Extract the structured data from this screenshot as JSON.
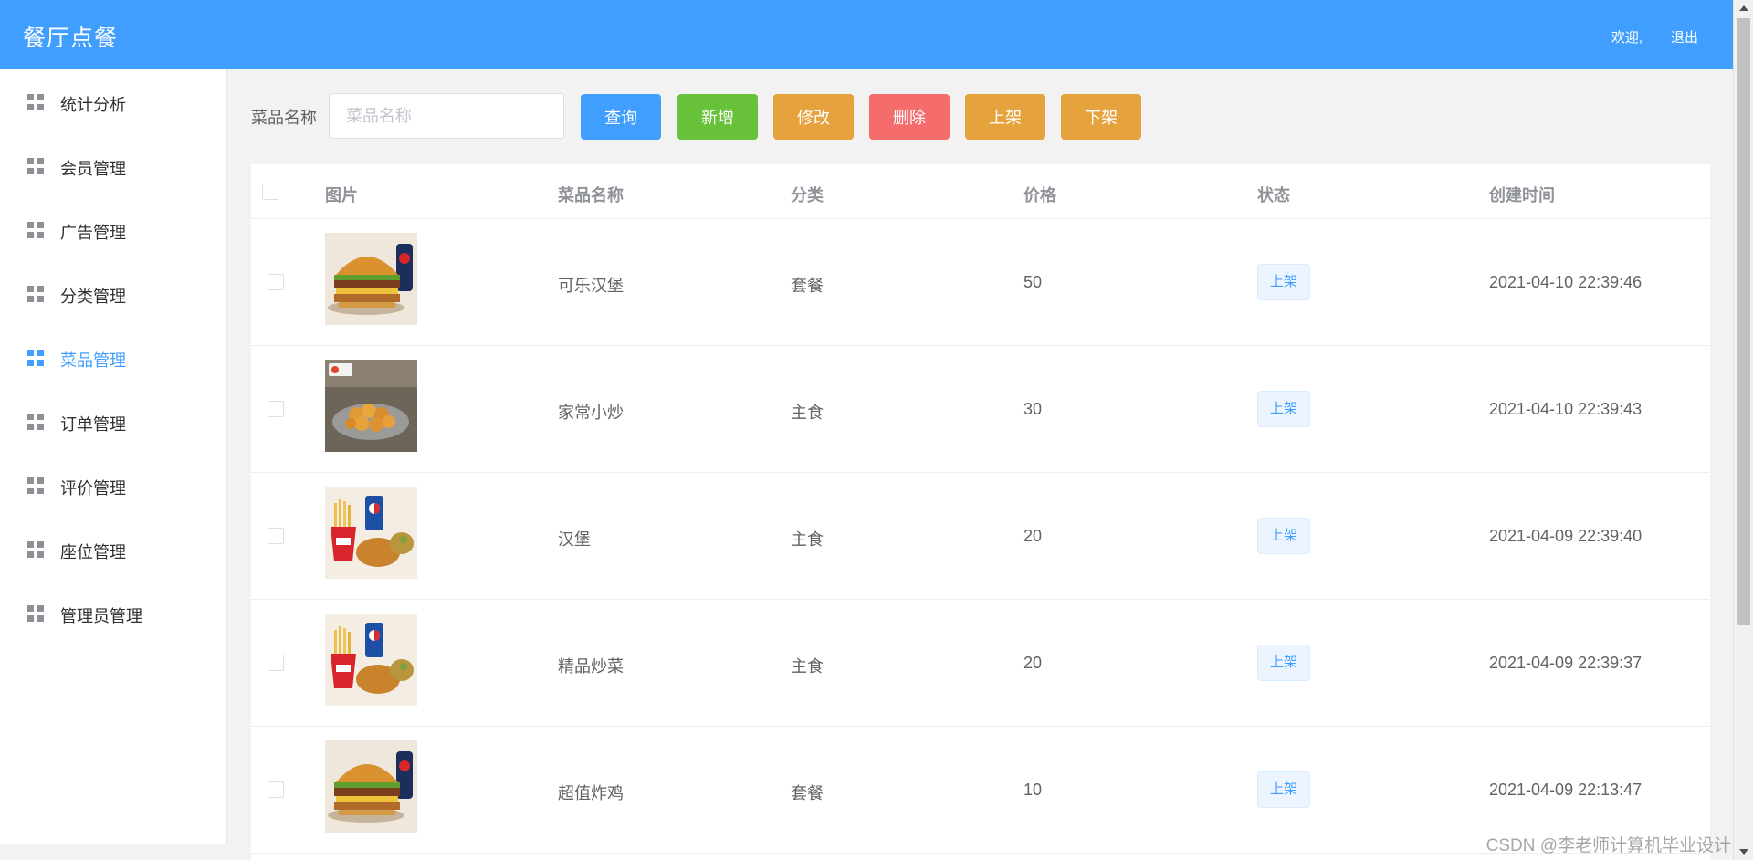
{
  "header": {
    "title": "餐厅点餐",
    "welcome": "欢迎,",
    "logout": "退出"
  },
  "sidebar": {
    "items": [
      {
        "label": "统计分析",
        "active": false
      },
      {
        "label": "会员管理",
        "active": false
      },
      {
        "label": "广告管理",
        "active": false
      },
      {
        "label": "分类管理",
        "active": false
      },
      {
        "label": "菜品管理",
        "active": true
      },
      {
        "label": "订单管理",
        "active": false
      },
      {
        "label": "评价管理",
        "active": false
      },
      {
        "label": "座位管理",
        "active": false
      },
      {
        "label": "管理员管理",
        "active": false
      }
    ]
  },
  "toolbar": {
    "search_label": "菜品名称",
    "search_placeholder": "菜品名称",
    "search_value": "",
    "buttons": [
      {
        "label": "查询",
        "color": "#409eff"
      },
      {
        "label": "新增",
        "color": "#67c23a"
      },
      {
        "label": "修改",
        "color": "#e6a23c"
      },
      {
        "label": "删除",
        "color": "#f56c6c"
      },
      {
        "label": "上架",
        "color": "#e6a23c"
      },
      {
        "label": "下架",
        "color": "#e6a23c"
      }
    ]
  },
  "table": {
    "columns": [
      "图片",
      "菜品名称",
      "分类",
      "价格",
      "状态",
      "创建时间"
    ],
    "rows": [
      {
        "image": "burger-image",
        "name": "可乐汉堡",
        "category": "套餐",
        "price": "50",
        "status": "上架",
        "created": "2021-04-10 22:39:46"
      },
      {
        "image": "fried-chicken-image",
        "name": "家常小炒",
        "category": "主食",
        "price": "30",
        "status": "上架",
        "created": "2021-04-10 22:39:43"
      },
      {
        "image": "combo-meal-image",
        "name": "汉堡",
        "category": "主食",
        "price": "20",
        "status": "上架",
        "created": "2021-04-09 22:39:40"
      },
      {
        "image": "combo-meal-image",
        "name": "精品炒菜",
        "category": "主食",
        "price": "20",
        "status": "上架",
        "created": "2021-04-09 22:39:37"
      },
      {
        "image": "burger-image",
        "name": "超值炸鸡",
        "category": "套餐",
        "price": "10",
        "status": "上架",
        "created": "2021-04-09 22:13:47"
      }
    ]
  },
  "watermark": "CSDN @李老师计算机毕业设计"
}
